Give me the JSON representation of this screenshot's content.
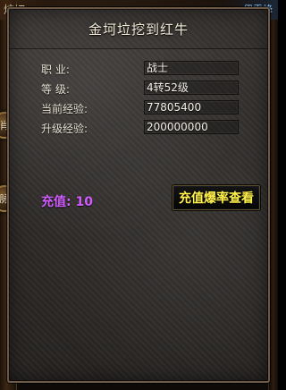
{
  "dialog": {
    "title": "金坷垃挖到红牛"
  },
  "player_info": {
    "rows": [
      {
        "label": "职  业:",
        "value": "战士"
      },
      {
        "label": "等  级:",
        "value": "4转52级"
      },
      {
        "label": "当前经验:",
        "value": "77805400"
      },
      {
        "label": "升级经验:",
        "value": "200000000"
      }
    ]
  },
  "recharge": {
    "text": "充值: 10",
    "button_label": "充值爆率查看"
  },
  "background": {
    "left_fragment": "炫切",
    "left_medallion_top": "肖",
    "left_medallion_bottom": "脉",
    "right_fragment": "伊雪峰"
  },
  "colors": {
    "panel_bg": "#2f2c2a",
    "title_text": "#f3ead8",
    "label_text": "#e7e0d1",
    "value_text": "#f4f0e6",
    "recharge_text": "#d15cff",
    "button_text": "#fff04a"
  }
}
